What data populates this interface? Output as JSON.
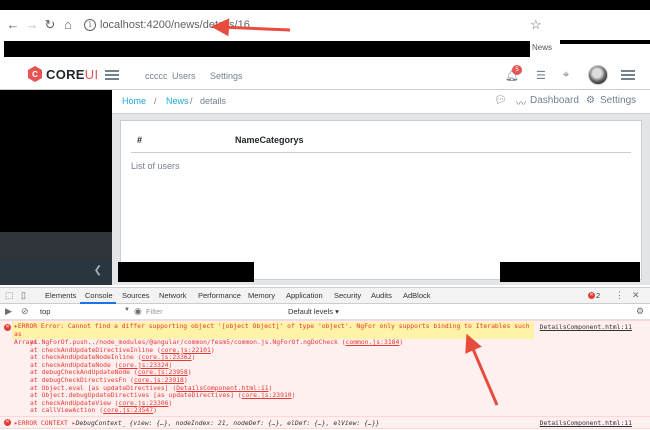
{
  "browser": {
    "url": "localhost:4200/news/details/16",
    "overlay_text": "News"
  },
  "header": {
    "logo_text": "CORE",
    "logo_accent": "UI",
    "logo_glyph": "C",
    "nav": [
      "ccccc",
      "Users",
      "Settings"
    ],
    "notification_count": "5"
  },
  "breadcrumb": {
    "items": [
      "Home",
      "News",
      "details"
    ],
    "separator": "/",
    "right_dashboard": "Dashboard",
    "right_settings": "Settings"
  },
  "table": {
    "columns": [
      "#",
      "NameCategorys"
    ],
    "list_label": "List of users"
  },
  "devtools": {
    "tabs": [
      "Elements",
      "Console",
      "Sources",
      "Network",
      "Performance",
      "Memory",
      "Application",
      "Security",
      "Audits",
      "AdBlock"
    ],
    "error_count": "2",
    "context": "top",
    "filter_placeholder": "Filter",
    "levels": "Default levels",
    "error_lines": [
      "▸ERROR Error: Cannot find a differ supporting object '[object Object]' of type 'object'. NgFor only supports binding to Iterables such as",
      "Arrays."
    ],
    "error_source": "DetailsComponent.html:11",
    "stack": [
      {
        "pre": "at NgForOf.push../node_modules/@angular/common/fesm5/common.js.NgForOf.ngDoCheck (",
        "link": "common.js:3184",
        "post": ")"
      },
      {
        "pre": "at checkAndUpdateDirectiveInline (",
        "link": "core.js:22101",
        "post": ")"
      },
      {
        "pre": "at checkAndUpdateNodeInline (",
        "link": "core.js:23362",
        "post": ")"
      },
      {
        "pre": "at checkAndUpdateNode (",
        "link": "core.js:23324",
        "post": ")"
      },
      {
        "pre": "at debugCheckAndUpdateNode (",
        "link": "core.js:23958",
        "post": ")"
      },
      {
        "pre": "at debugCheckDirectivesFn (",
        "link": "core.js:23918",
        "post": ")"
      },
      {
        "pre": "at Object.eval [as updateDirectives] (",
        "link": "DetailsComponent.html:11",
        "post": ")"
      },
      {
        "pre": "at Object.debugUpdateDirectives [as updateDirectives] (",
        "link": "core.js:23910",
        "post": ")"
      },
      {
        "pre": "at checkAndUpdateView (",
        "link": "core.js:23306",
        "post": ")"
      },
      {
        "pre": "at callViewAction (",
        "link": "core.js:23547",
        "post": ")"
      }
    ],
    "error2_prefix": "▸ERROR CONTEXT ▸",
    "error2_body": "DebugContext_ {view: {…}, nodeIndex: 21, nodeDef: {…}, elDef: {…}, elView: {…}}",
    "error2_source": "DetailsComponent.html:11"
  },
  "colors": {
    "accent": "#20a8d8",
    "error": "#e53935",
    "arrow": "#e74c3c",
    "highlight": "#fff3a8"
  }
}
